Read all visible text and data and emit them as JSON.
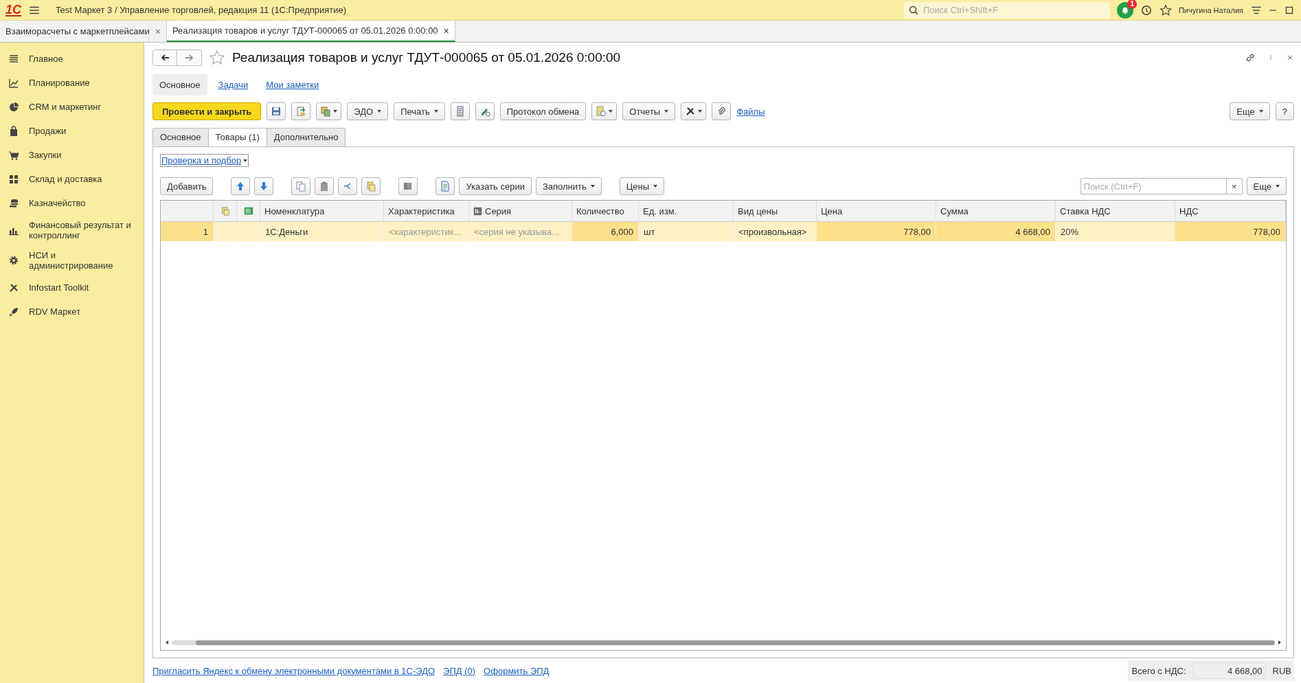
{
  "titlebar": {
    "logo": "1С",
    "title": "Test Маркет 3 / Управление торговлей, редакция 11  (1С:Предприятие)",
    "search_placeholder": "Поиск Ctrl+Shift+F",
    "notifications": "1",
    "user": "Пичугина Наталия"
  },
  "open_tabs": [
    {
      "label": "Взаиморасчеты с маркетплейсами",
      "selected": false,
      "close": "×"
    },
    {
      "label": "Реализация товаров и услуг ТДУТ-000065 от 05.01.2026 0:00:00",
      "selected": true,
      "close": "×"
    }
  ],
  "sidebar": {
    "items": [
      {
        "label": "Главное"
      },
      {
        "label": "Планирование"
      },
      {
        "label": "CRM и маркетинг"
      },
      {
        "label": "Продажи"
      },
      {
        "label": "Закупки"
      },
      {
        "label": "Склад и доставка"
      },
      {
        "label": "Казначейство"
      },
      {
        "label": "Финансовый результат и контроллинг"
      },
      {
        "label": "НСИ и администрирование"
      },
      {
        "label": "Infostart Toolkit"
      },
      {
        "label": "RDV Маркет"
      }
    ]
  },
  "form": {
    "title": "Реализация товаров и услуг ТДУТ-000065 от 05.01.2026 0:00:00",
    "favorite": false,
    "sections": [
      {
        "label": "Основное",
        "selected": true
      },
      {
        "label": "Задачи",
        "selected": false
      },
      {
        "label": "Мои заметки",
        "selected": false
      }
    ],
    "toolbar": [
      {
        "kind": "primary",
        "label": "Провести и закрыть",
        "dropdown": false
      },
      {
        "kind": "icon",
        "dropdown": false
      },
      {
        "kind": "icon",
        "dropdown": false
      },
      {
        "kind": "icon",
        "dropdown": true
      },
      {
        "kind": "text",
        "label": "ЭДО",
        "dropdown": true
      },
      {
        "kind": "text",
        "label": "Печать",
        "dropdown": true
      },
      {
        "kind": "icon",
        "dropdown": false
      },
      {
        "kind": "icon",
        "dropdown": false
      },
      {
        "kind": "text",
        "label": "Протокол обмена",
        "dropdown": false
      },
      {
        "kind": "icon",
        "dropdown": true
      },
      {
        "kind": "text",
        "label": "Отчеты",
        "dropdown": true
      },
      {
        "kind": "icon",
        "dropdown": true
      },
      {
        "kind": "icon",
        "dropdown": false
      },
      {
        "kind": "link",
        "label": "Файлы"
      },
      {
        "kind": "spacer"
      },
      {
        "kind": "text",
        "label": "Еще",
        "dropdown": true
      },
      {
        "kind": "text",
        "label": "?",
        "dropdown": false
      }
    ],
    "page_tabs": [
      {
        "label": "Основное",
        "selected": false
      },
      {
        "label": "Товары (1)",
        "selected": true
      },
      {
        "label": "Дополнительно",
        "selected": false
      }
    ],
    "check_link": "Проверка и подбор",
    "table_toolbar": [
      {
        "kind": "text",
        "label": "Добавить",
        "dropdown": false
      },
      {
        "kind": "gap"
      },
      {
        "kind": "icon",
        "dropdown": false
      },
      {
        "kind": "icon",
        "dropdown": false
      },
      {
        "kind": "gap"
      },
      {
        "kind": "icon",
        "dropdown": false
      },
      {
        "kind": "icon",
        "dropdown": false
      },
      {
        "kind": "icon",
        "dropdown": false
      },
      {
        "kind": "icon",
        "dropdown": false
      },
      {
        "kind": "gap"
      },
      {
        "kind": "icon",
        "dropdown": false
      },
      {
        "kind": "gap"
      },
      {
        "kind": "icon",
        "dropdown": false
      },
      {
        "kind": "text",
        "label": "Указать серии",
        "dropdown": false
      },
      {
        "kind": "text",
        "label": "Заполнить",
        "dropdown": true
      },
      {
        "kind": "gap"
      },
      {
        "kind": "text",
        "label": "Цены",
        "dropdown": true
      }
    ],
    "table_search": {
      "placeholder": "Поиск (Ctrl+F)",
      "clear": "×"
    },
    "table_more": "Еще",
    "table": {
      "columns": [
        {
          "kind": "blank"
        },
        {
          "kind": "icon"
        },
        {
          "kind": "icon"
        },
        {
          "label": "Номенклатура"
        },
        {
          "label": "Характеристика"
        },
        {
          "label": "Серия"
        },
        {
          "label": "Количество"
        },
        {
          "label": "Ед. изм."
        },
        {
          "label": "Вид цены"
        },
        {
          "label": "Цена"
        },
        {
          "label": "Сумма"
        },
        {
          "label": "Ставка НДС"
        },
        {
          "label": "НДС"
        }
      ],
      "rows": [
        {
          "selected": true,
          "cells": [
            {
              "kind": "number",
              "text": "1"
            },
            {
              "kind": "empty"
            },
            {
              "kind": "empty"
            },
            {
              "kind": "text",
              "text": "1С:Деньги"
            },
            {
              "kind": "placeholder",
              "text": "<характеристик..."
            },
            {
              "kind": "placeholder",
              "text": "<серия не указыва..."
            },
            {
              "kind": "number",
              "text": "6,000"
            },
            {
              "kind": "text",
              "text": "шт"
            },
            {
              "kind": "text",
              "text": "<произвольная>"
            },
            {
              "kind": "number",
              "text": "778,00"
            },
            {
              "kind": "number",
              "text": "4 668,00"
            },
            {
              "kind": "text",
              "text": "20%"
            },
            {
              "kind": "number",
              "text": "778,00"
            }
          ]
        }
      ]
    },
    "footer_links": [
      "Пригласить Яндекс к обмену электронными документами в 1С-ЭДО",
      "ЭПД (0)",
      "Оформить ЭПД"
    ],
    "total": {
      "label": "Всего с НДС:",
      "value": "4 668,00",
      "currency": "RUB"
    }
  }
}
